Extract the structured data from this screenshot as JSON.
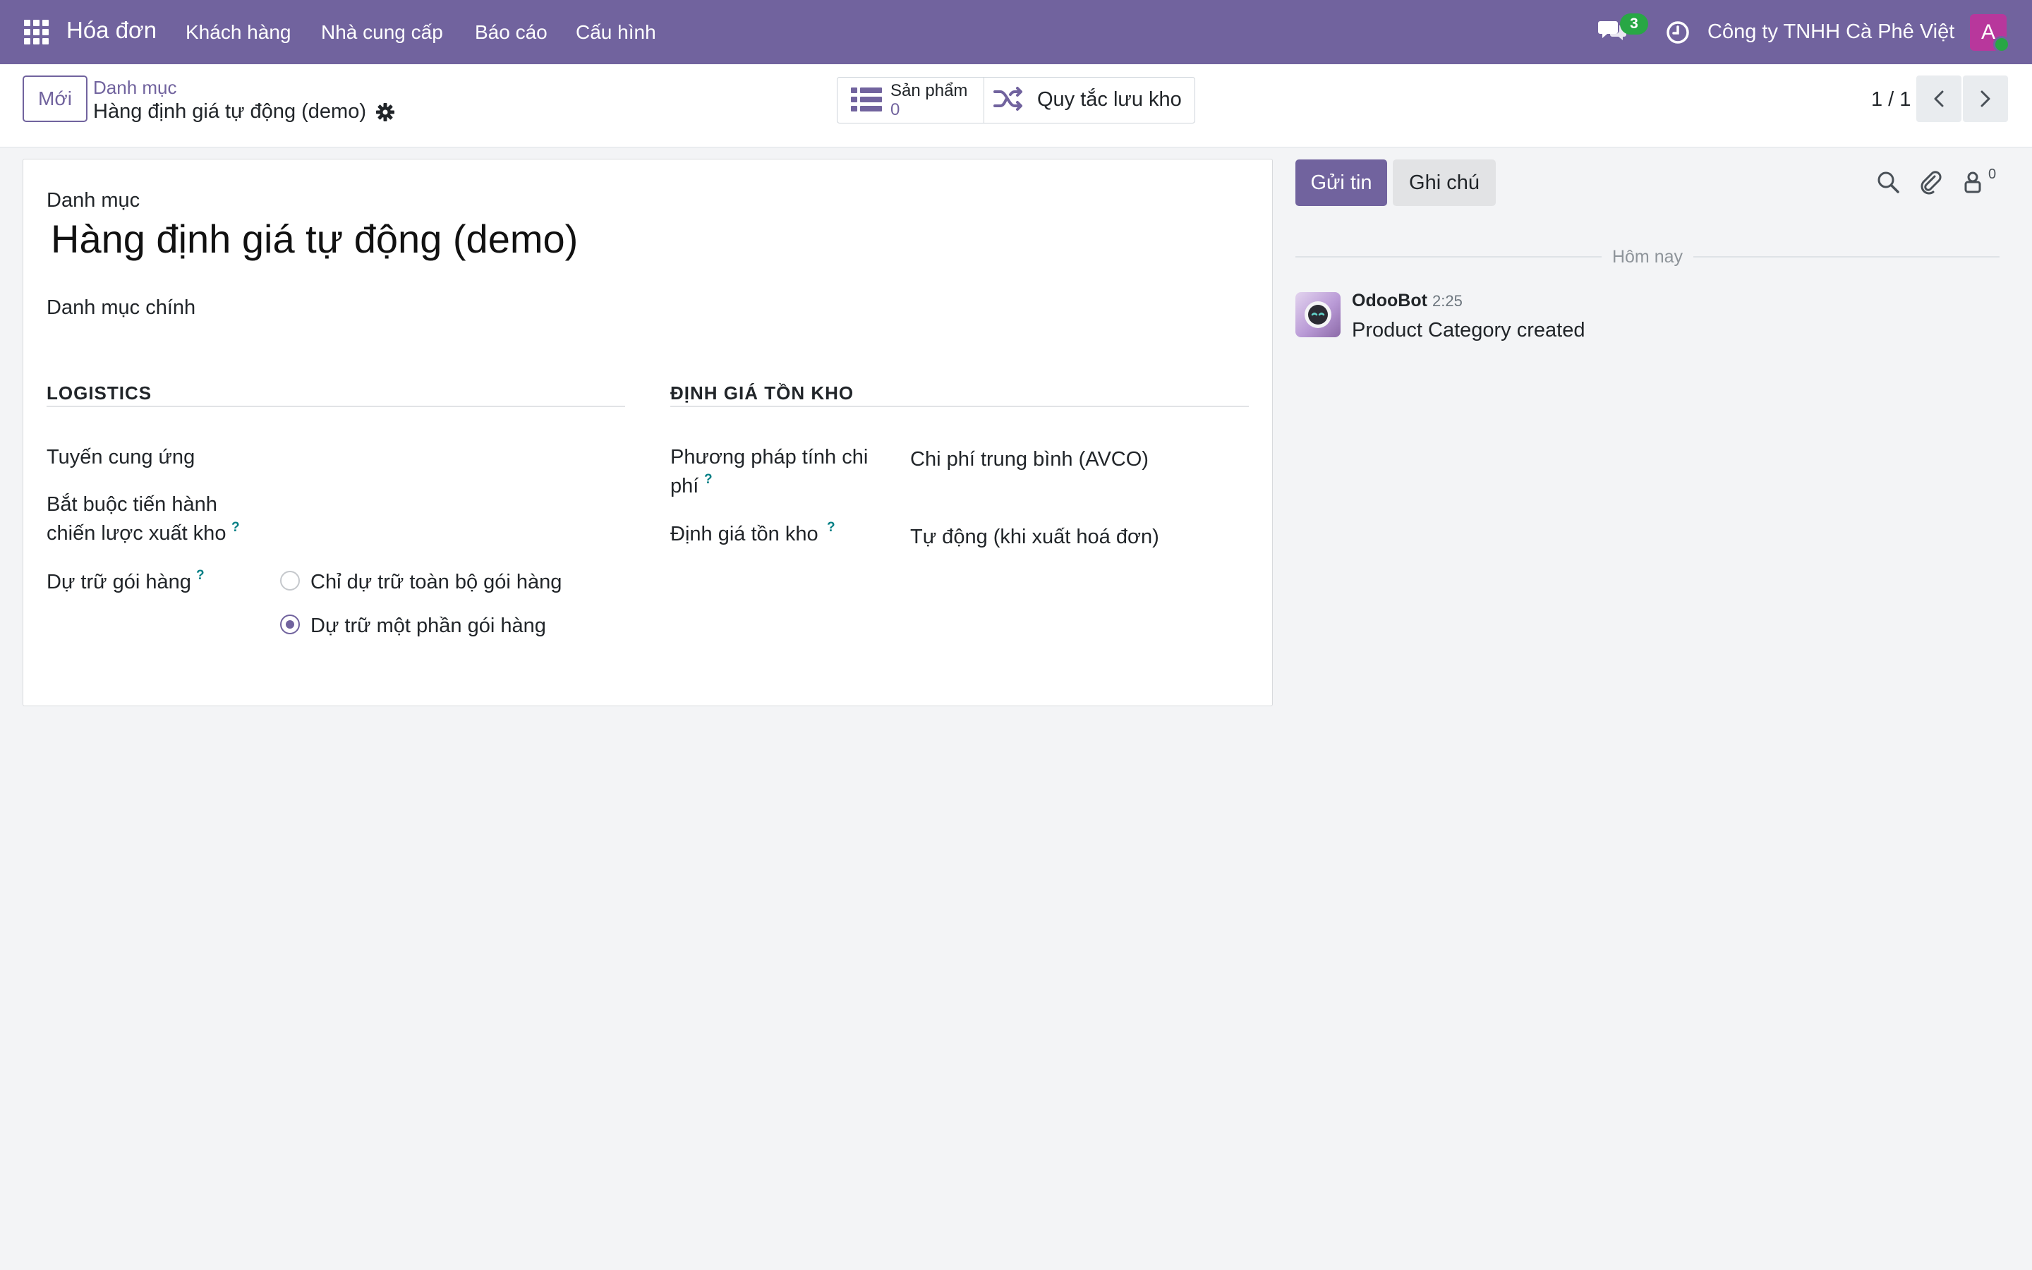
{
  "navbar": {
    "app_name": "Hóa đơn",
    "menu": [
      "Khách hàng",
      "Nhà cung cấp",
      "Báo cáo",
      "Cấu hình"
    ],
    "message_count": "3",
    "company": "Công ty TNHH Cà Phê Việt",
    "avatar_letter": "A"
  },
  "control": {
    "new_button": "Mới",
    "breadcrumb_parent": "Danh mục",
    "breadcrumb_current": "Hàng định giá tự động (demo)",
    "smart_products_label": "Sản phẩm",
    "smart_products_value": "0",
    "smart_rules_label": "Quy tắc lưu kho",
    "pager": "1 / 1"
  },
  "form": {
    "name_label": "Danh mục",
    "name_value": "Hàng định giá tự động (demo)",
    "parent_label": "Danh mục chính",
    "logistics": {
      "title": "LOGISTICS",
      "routes_label": "Tuyến cung ứng",
      "removal_label_1": "Bắt buộc tiến hành",
      "removal_label_2": "chiến lược xuất kho",
      "reserve_label": "Dự trữ gói hàng",
      "reserve_options": [
        "Chỉ dự trữ toàn bộ gói hàng",
        "Dự trữ một phần gói hàng"
      ],
      "reserve_selected": "Dự trữ một phần gói hàng"
    },
    "valuation": {
      "title": "ĐỊNH GIÁ TỒN KHO",
      "cost_method_label_1": "Phương pháp tính chi",
      "cost_method_label_2": "phí",
      "cost_method_value": "Chi phí trung bình (AVCO)",
      "valuation_label": "Định giá tồn kho",
      "valuation_value": "Tự động (khi xuất hoá đơn)"
    },
    "help_mark": "?"
  },
  "chatter": {
    "send_button": "Gửi tin",
    "note_button": "Ghi chú",
    "follower_count": "0",
    "date_separator": "Hôm nay",
    "message": {
      "author": "OdooBot",
      "time": "2:25",
      "body": "Product Category created"
    }
  },
  "colors": {
    "brand": "#71639e",
    "badge_green": "#28a745",
    "help_teal": "#017e84",
    "avatar_pink": "#b8379c"
  },
  "icons": [
    "apps-grid-icon",
    "chat-bubbles-icon",
    "clock-icon",
    "gear-icon",
    "list-icon",
    "shuffle-icon",
    "chevron-left-icon",
    "chevron-right-icon",
    "search-icon",
    "paperclip-icon",
    "follower-icon",
    "odoobot-avatar-icon"
  ]
}
